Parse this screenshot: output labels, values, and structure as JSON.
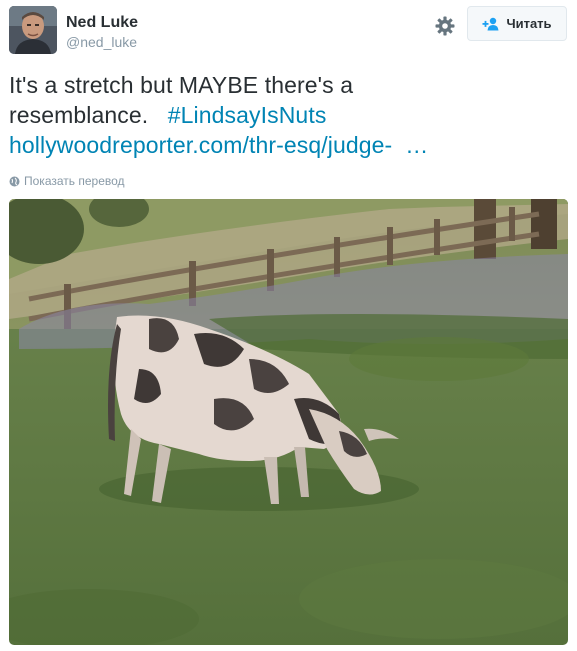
{
  "user": {
    "name": "Ned Luke",
    "handle": "@ned_luke"
  },
  "actions": {
    "follow_label": "Читать"
  },
  "tweet": {
    "text_line1": "It's a stretch but MAYBE there's a",
    "text_line2_prefix": "resemblance.",
    "hashtag": "#LindsayIsNuts",
    "link": "hollywoodreporter.com/thr-esq/judge-",
    "link_ellipsis": "…"
  },
  "translate": {
    "label": "Показать перевод"
  },
  "colors": {
    "link": "#0084b4",
    "muted": "#8899a6",
    "text": "#292f33"
  },
  "icons": {
    "settings": "gear-icon",
    "follow": "add-user-icon",
    "translate": "globe-icon"
  }
}
